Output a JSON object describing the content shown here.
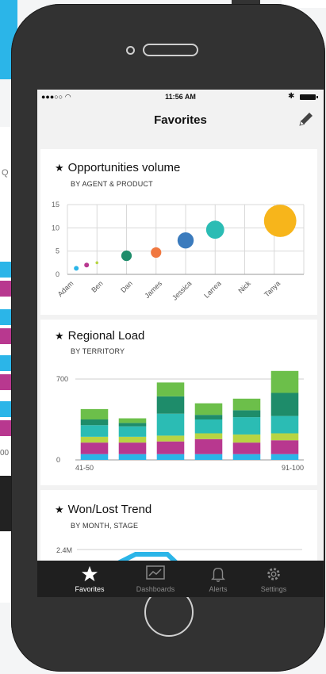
{
  "status": {
    "signal": "●●●○○",
    "time": "11:56 AM",
    "bluetooth": "✱"
  },
  "nav": {
    "title": "Favorites"
  },
  "cards": {
    "opportunities": {
      "title": "Opportunities volume",
      "subtitle": "BY AGENT & PRODUCT"
    },
    "regional": {
      "title": "Regional Load",
      "subtitle": "BY TERRITORY"
    },
    "wonlost": {
      "title": "Won/Lost Trend",
      "subtitle": "BY MONTH, STAGE",
      "y_tick": "2.4M"
    }
  },
  "tabs": [
    {
      "label": "Favorites",
      "icon": "star-icon",
      "active": true
    },
    {
      "label": "Dashboards",
      "icon": "chart-icon",
      "active": false
    },
    {
      "label": "Alerts",
      "icon": "bell-icon",
      "active": false
    },
    {
      "label": "Settings",
      "icon": "gear-icon",
      "active": false
    }
  ],
  "background": {
    "left_label": "Q",
    "left_tick": "00"
  },
  "colors": {
    "cyan": "#2bb5e8",
    "magenta": "#b8388f",
    "lime": "#b7d443",
    "teal": "#2bbcb4",
    "dark_green": "#1e8c6a",
    "green": "#6cbf4a",
    "orange": "#f07840",
    "blue": "#3b7bbd",
    "yellow": "#f7b51b"
  },
  "chart_data": [
    {
      "type": "scatter",
      "title": "Opportunities volume",
      "subtitle": "BY AGENT & PRODUCT",
      "categories": [
        "Adam",
        "Ben",
        "Dan",
        "James",
        "Jessica",
        "Larrea",
        "Nick",
        "Tanya"
      ],
      "ylim": [
        0,
        15
      ],
      "y_ticks": [
        0,
        5,
        10,
        15
      ],
      "grid": true,
      "points": [
        {
          "x": 0.3,
          "y": 1.3,
          "size": 1.0,
          "color": "#2bb5e8"
        },
        {
          "x": 0.65,
          "y": 2.0,
          "size": 1.0,
          "color": "#b8388f"
        },
        {
          "x": 1.0,
          "y": 2.5,
          "size": 0.6,
          "color": "#b7d443"
        },
        {
          "x": 2.0,
          "y": 4.0,
          "size": 2.2,
          "color": "#1e8c6a"
        },
        {
          "x": 3.0,
          "y": 4.7,
          "size": 2.2,
          "color": "#f07840"
        },
        {
          "x": 4.0,
          "y": 7.3,
          "size": 3.4,
          "color": "#3b7bbd"
        },
        {
          "x": 5.0,
          "y": 9.6,
          "size": 3.8,
          "color": "#2bbcb4"
        },
        {
          "x": 7.2,
          "y": 11.5,
          "size": 6.8,
          "color": "#f7b51b"
        }
      ]
    },
    {
      "type": "bar",
      "title": "Regional Load",
      "subtitle": "BY TERRITORY",
      "stacked": true,
      "ylim": [
        0,
        700
      ],
      "y_ticks": [
        0,
        700
      ],
      "x_labels": [
        "41-50",
        "91-100"
      ],
      "series_colors": [
        "#2bb5e8",
        "#b8388f",
        "#b7d443",
        "#2bbcb4",
        "#1e8c6a",
        "#6cbf4a"
      ],
      "bars": [
        [
          50,
          100,
          50,
          100,
          50,
          90
        ],
        [
          50,
          100,
          50,
          90,
          30,
          40
        ],
        [
          50,
          110,
          50,
          190,
          150,
          120
        ],
        [
          50,
          130,
          50,
          120,
          40,
          100
        ],
        [
          50,
          100,
          70,
          150,
          60,
          100
        ],
        [
          50,
          120,
          60,
          150,
          200,
          190
        ]
      ]
    }
  ]
}
